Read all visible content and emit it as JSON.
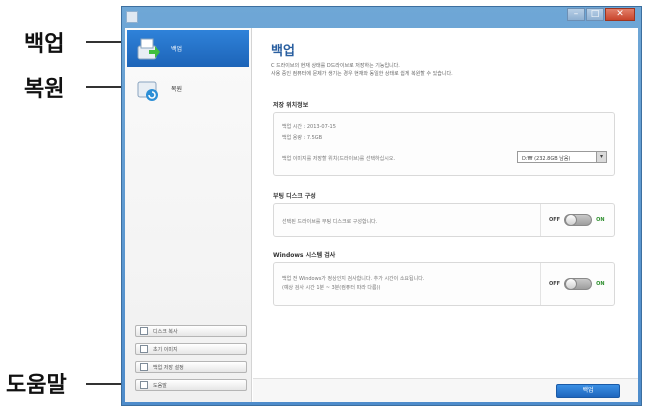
{
  "callouts": {
    "backup": "백업",
    "restore": "복원",
    "help": "도움말"
  },
  "sidebar": {
    "items": [
      {
        "label": "백업",
        "icon": "backup-drive-icon",
        "active": true
      },
      {
        "label": "복원",
        "icon": "restore-drive-icon",
        "active": false
      }
    ],
    "buttons": [
      {
        "label": "디스크 복사"
      },
      {
        "label": "초기 이미지"
      },
      {
        "label": "백업 저장 설정"
      },
      {
        "label": "도움말"
      }
    ]
  },
  "main": {
    "title": "백업",
    "description_line1": "C 드라이브의 현재 상태를 D드라이브로 저장하는 기능입니다.",
    "description_line2": "사용 중인 컴퓨터에 문제가 생기는 경우 현재와 동일한 상태로 쉽게 복원할 수 있습니다.",
    "section_backup_info": {
      "title": "저장 위치정보",
      "time_line": "백업 시간 : 2013-07-15",
      "size_line": "백업 용량 : 7.5GB",
      "drive_line": "백업 이미지를 저장할 위치(드라이브)를 선택하십시오.",
      "drive_value": "D:₩ (232.8GB 남음)"
    },
    "section_boot_disk": {
      "title": "부팅 디스크 구성",
      "text": "선택된 드라이브를 부팅 디스크로 구성합니다.",
      "off": "OFF",
      "on": "ON"
    },
    "section_windows_check": {
      "title": "Windows 시스템 검사",
      "text_line1": "백업 전 Windows가 정상인지 검사합니다. 추가 시간이 소요됩니다.",
      "text_line2": "(예상 검사 시간 1분 ~ 3분(컴퓨터 따라 다름))",
      "off": "OFF",
      "on": "ON"
    },
    "primary_button": "백업"
  },
  "colors": {
    "accent": "#1d64b8",
    "window_frame": "#4e8ccb"
  }
}
